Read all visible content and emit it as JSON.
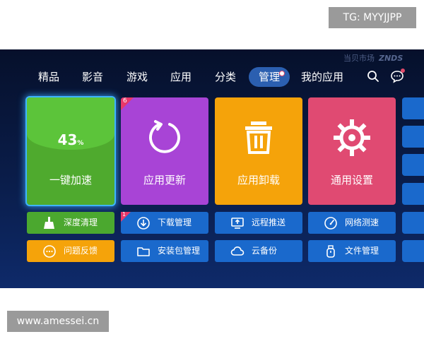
{
  "watermarks": {
    "telegram": "TG: MYYJJPP",
    "site": "www.amessei.cn"
  },
  "brand": {
    "name": "当贝市场",
    "partner": "ZNDS"
  },
  "nav": {
    "items": [
      {
        "label": "精品"
      },
      {
        "label": "影音"
      },
      {
        "label": "游戏"
      },
      {
        "label": "应用"
      },
      {
        "label": "分类"
      },
      {
        "label": "管理"
      },
      {
        "label": "我的应用"
      }
    ],
    "active": "管理"
  },
  "tiles": {
    "speed": {
      "percent": "43",
      "unit": "%",
      "label": "一键加速"
    },
    "update": {
      "badge": "6",
      "label": "应用更新"
    },
    "uninstall": {
      "label": "应用卸载"
    },
    "settings": {
      "label": "通用设置"
    }
  },
  "actions": {
    "deep_clean": {
      "label": "深度清理",
      "icon": "broom-icon"
    },
    "download_manager": {
      "label": "下载管理",
      "icon": "download-icon",
      "badge": "1"
    },
    "remote_push": {
      "label": "远程推送",
      "icon": "monitor-upload-icon"
    },
    "network_speed": {
      "label": "网络测速",
      "icon": "speedometer-icon"
    },
    "feedback": {
      "label": "问题反馈",
      "icon": "chat-dots-icon"
    },
    "package_manager": {
      "label": "安装包管理",
      "icon": "folder-icon"
    },
    "cloud_backup": {
      "label": "云备份",
      "icon": "cloud-icon"
    },
    "file_manager": {
      "label": "文件管理",
      "icon": "usb-icon"
    }
  },
  "colors": {
    "green": "#4faa2e",
    "purple": "#a844d6",
    "orange": "#f5a30a",
    "pink": "#e04a72",
    "blue": "#1a69cc",
    "background": "#0a1d4a"
  }
}
